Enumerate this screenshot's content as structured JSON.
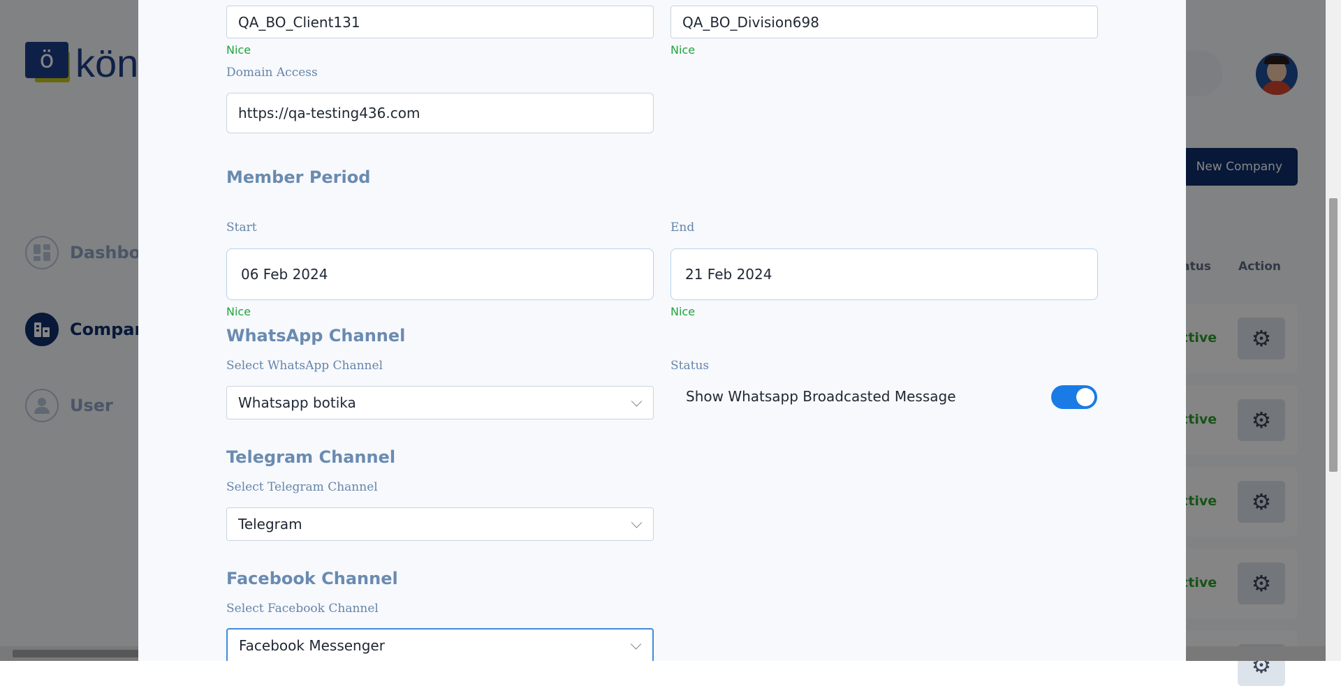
{
  "background": {
    "logo_text": "kön",
    "logo_mark_glyph": "ö",
    "sidebar": [
      {
        "label": "Dashboard",
        "icon": "dashboard-icon"
      },
      {
        "label": "Company",
        "icon": "company-icon"
      },
      {
        "label": "User",
        "icon": "user-icon"
      }
    ],
    "new_company_label": "New Company",
    "table_headers": {
      "status": "tatus",
      "action": "Action"
    },
    "rows": [
      {
        "status": "ctive"
      },
      {
        "status": "ctive"
      },
      {
        "status": "ctive"
      },
      {
        "status": "ctive"
      }
    ],
    "colors": {
      "accent": "#0f2f6b",
      "active_status": "#2ca02c"
    }
  },
  "form": {
    "client_value": "QA_BO_Client131",
    "client_feedback": "Nice",
    "division_value": "QA_BO_Division698",
    "division_feedback": "Nice",
    "domain_label": "Domain Access",
    "domain_value": "https://qa-testing436.com",
    "member_period_title": "Member Period",
    "start_label": "Start",
    "start_value": "06 Feb 2024",
    "start_feedback": "Nice",
    "end_label": "End",
    "end_value": "21 Feb 2024",
    "end_feedback": "Nice",
    "whatsapp_title": "WhatsApp Channel",
    "whatsapp_select_label": "Select WhatsApp Channel",
    "whatsapp_value": "Whatsapp botika",
    "status_label": "Status",
    "broadcast_toggle_label": "Show Whatsapp Broadcasted Message",
    "broadcast_toggle_on": true,
    "telegram_title": "Telegram Channel",
    "telegram_select_label": "Select Telegram Channel",
    "telegram_value": "Telegram",
    "facebook_title": "Facebook Channel",
    "facebook_select_label": "Select Facebook Channel",
    "facebook_value": "Facebook Messenger",
    "colors": {
      "label": "#6584a8",
      "success": "#1ea53a",
      "toggle": "#1a7be6"
    }
  }
}
